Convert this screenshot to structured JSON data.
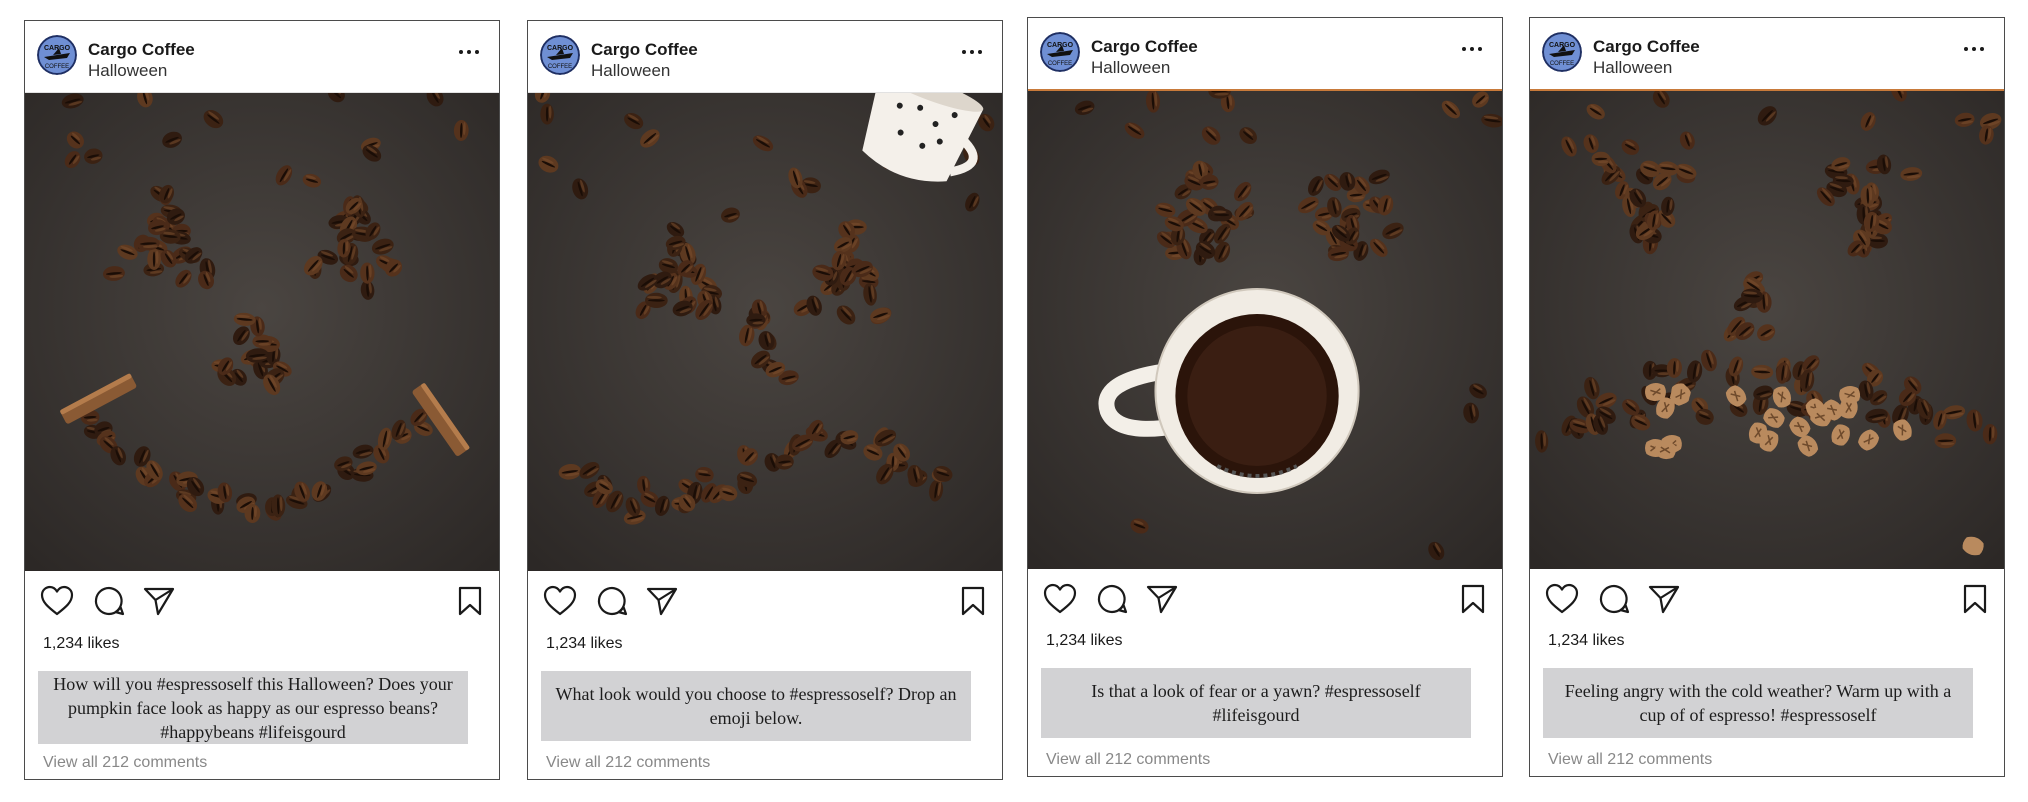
{
  "posts": [
    {
      "account": "Cargo Coffee",
      "location": "Halloween",
      "likes": "1,234 likes",
      "caption": "How will you #espressoself this Halloween? Does your pumpkin face look as happy as our espresso beans? #happybeans #lifeisgourd",
      "comments_link": "View all 212 comments",
      "photo_subject": "happy-bean-face"
    },
    {
      "account": "Cargo Coffee",
      "location": "Halloween",
      "likes": "1,234 likes",
      "caption": "What look would you choose to #espressoself? Drop an emoji below.",
      "comments_link": "View all 212 comments",
      "photo_subject": "wavy-bean-face"
    },
    {
      "account": "Cargo Coffee",
      "location": "Halloween",
      "likes": "1,234 likes",
      "caption": "Is that a look of fear or a yawn? #espressoself #lifeisgourd",
      "comments_link": "View all 212 comments",
      "photo_subject": "espresso-cup-face"
    },
    {
      "account": "Cargo Coffee",
      "location": "Halloween",
      "likes": "1,234 likes",
      "caption": "Feeling angry with the cold weather? Warm up with a cup of of espresso! #espressoself",
      "comments_link": "View all 212 comments",
      "photo_subject": "angry-bean-face"
    }
  ],
  "icons": {
    "like": "heart-icon",
    "comment": "comment-icon",
    "share": "share-icon",
    "save": "bookmark-icon",
    "more": "more-options-icon"
  },
  "colors": {
    "card_border": "#4b4b4b",
    "caption_background": "#d2d2d4",
    "comments_text": "#888888",
    "photo_background": "#3a3532",
    "bean": "#4a2a18",
    "accent_orange": "#c87a3a"
  }
}
